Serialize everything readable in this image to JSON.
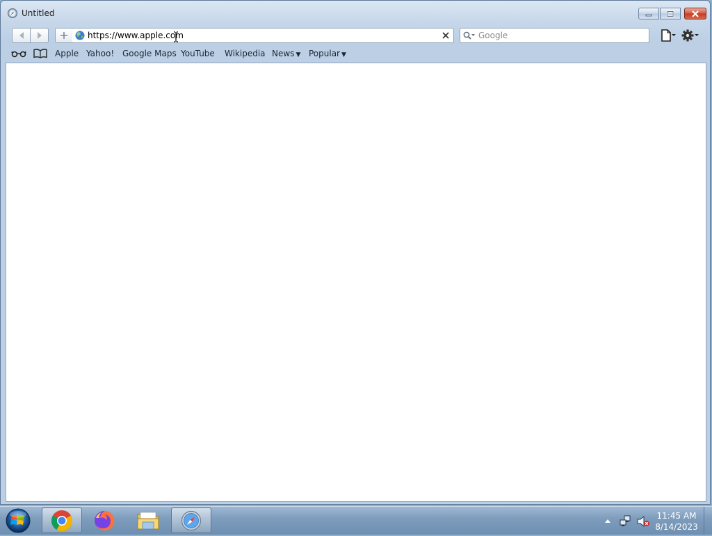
{
  "window": {
    "title": "Untitled"
  },
  "toolbar": {
    "address": {
      "value": "https://www.apple.com",
      "placeholder": ""
    },
    "search": {
      "value": "",
      "placeholder": "Google"
    }
  },
  "bookmarks": {
    "items": [
      {
        "label": "Apple"
      },
      {
        "label": "Yahoo!"
      },
      {
        "label": "Google Maps"
      },
      {
        "label": "YouTube"
      },
      {
        "label": "Wikipedia"
      },
      {
        "label": "News",
        "dropdown": true
      },
      {
        "label": "Popular",
        "dropdown": true
      }
    ]
  },
  "taskbar": {
    "items": [
      {
        "name": "chrome-icon"
      },
      {
        "name": "firefox-icon"
      },
      {
        "name": "windows-explorer-icon"
      },
      {
        "name": "safari-icon",
        "active": true
      }
    ],
    "clock": {
      "time": "11:45 AM",
      "date": "8/14/2023"
    }
  },
  "colors": {
    "frame": "#bccfe5",
    "taskbar": "#7f9dbd",
    "close_button": "#c43b20",
    "content_bg": "#ffffff"
  }
}
